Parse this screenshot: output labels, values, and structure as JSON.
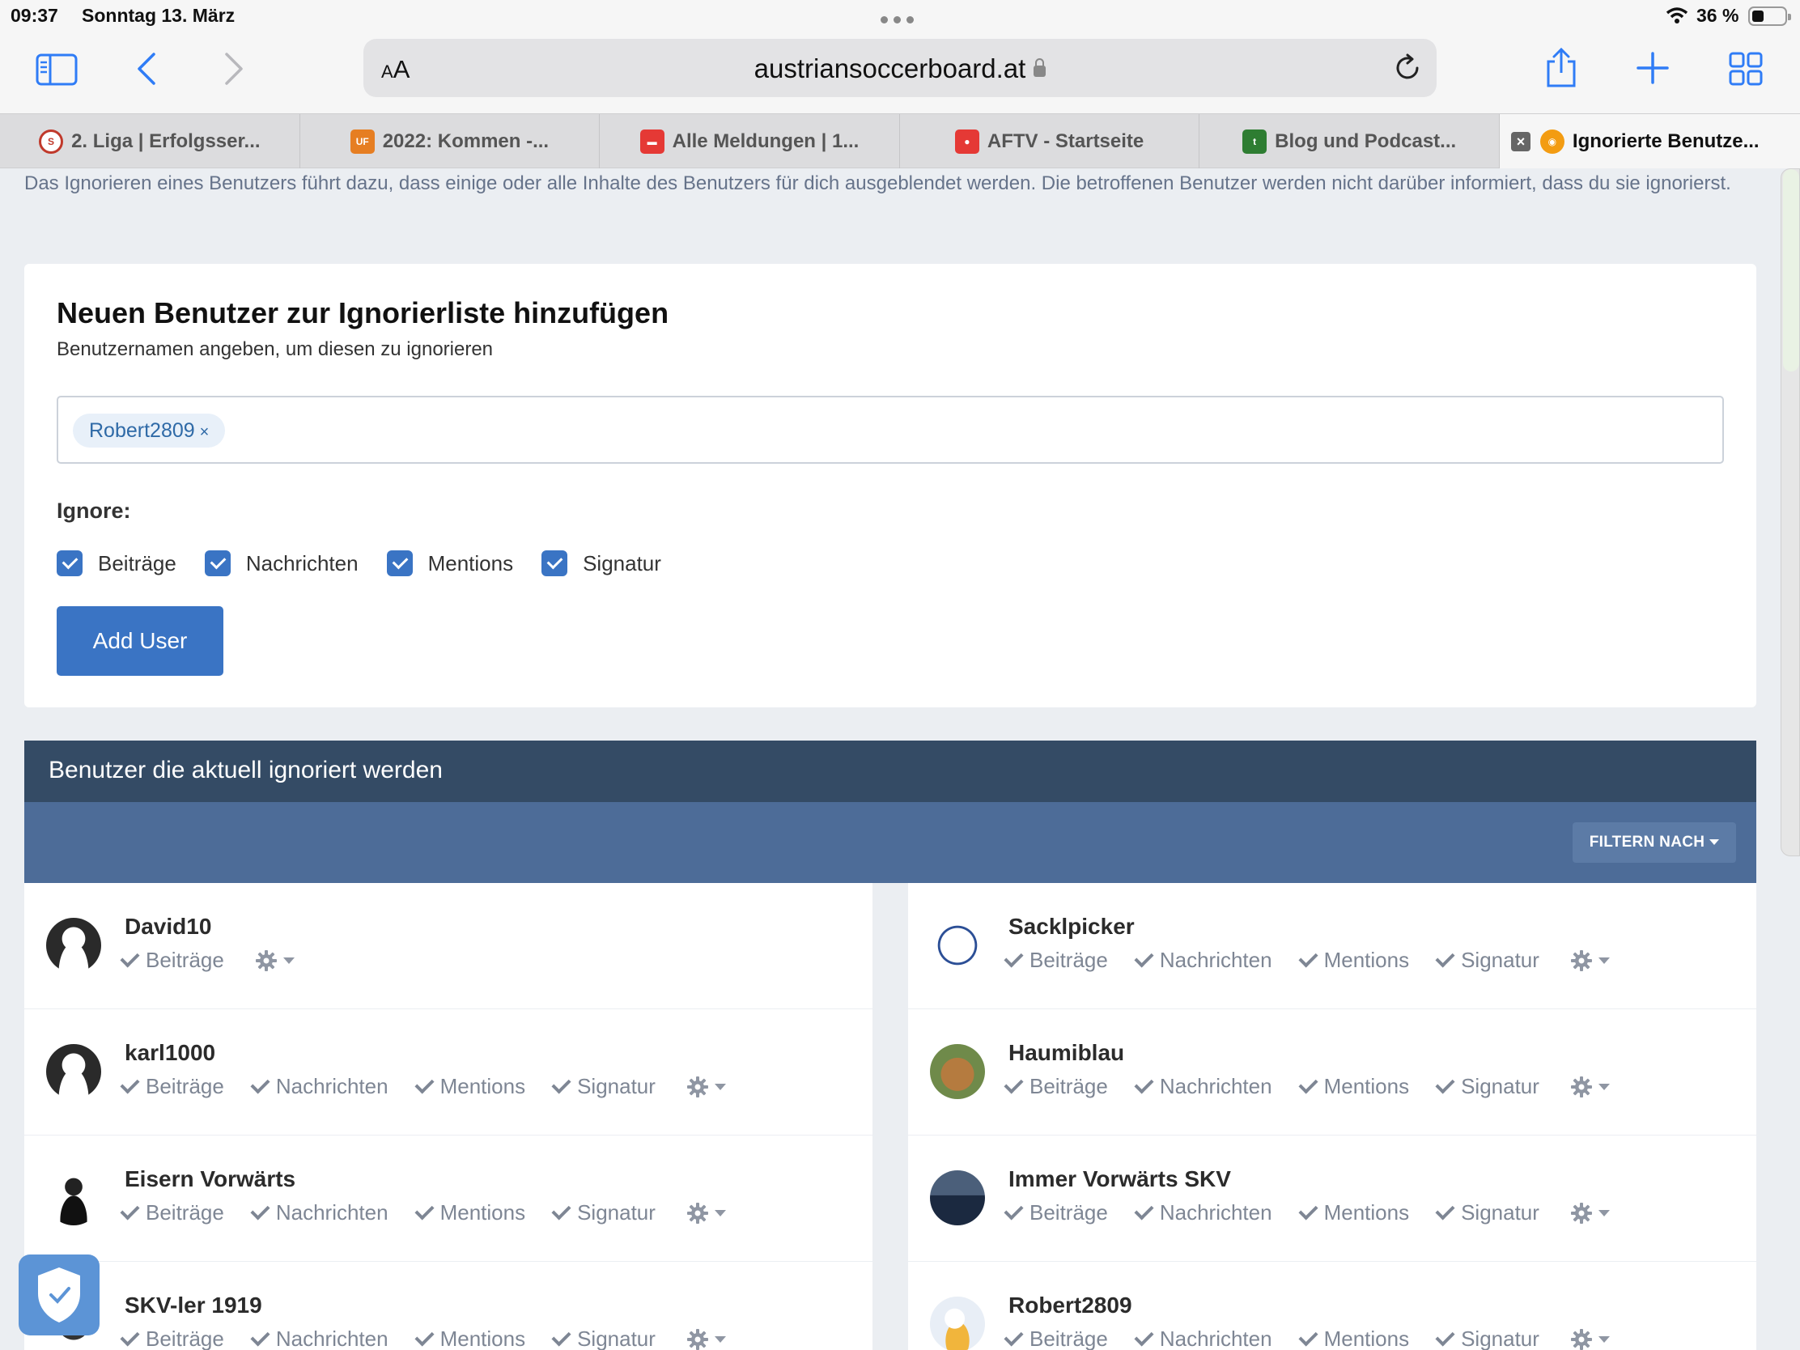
{
  "status": {
    "time": "09:37",
    "date": "Sonntag 13. März",
    "battery": "36 %"
  },
  "browser": {
    "aa_label": "AA",
    "url": "austriansoccerboard.at",
    "tabs": [
      {
        "label": "2. Liga | Erfolgsser...",
        "fav_color": "#c0392b"
      },
      {
        "label": "2022: Kommen -...",
        "fav_color": "#e67e22"
      },
      {
        "label": "Alle Meldungen | 1...",
        "fav_color": "#e53935"
      },
      {
        "label": "AFTV - Startseite",
        "fav_color": "#e53935"
      },
      {
        "label": "Blog und Podcast...",
        "fav_color": "#2e7d32"
      },
      {
        "label": "Ignorierte Benutze...",
        "fav_color": "#f39c12"
      }
    ]
  },
  "page": {
    "intro": "Das Ignorieren eines Benutzers führt dazu, dass einige oder alle Inhalte des Benutzers für dich ausgeblendet werden. Die betroffenen Benutzer werden nicht darüber informiert, dass du sie ignorierst.",
    "add_form": {
      "title": "Neuen Benutzer zur Ignorierliste hinzufügen",
      "subtitle": "Benutzernamen angeben, um diesen zu ignorieren",
      "chip": "Robert2809",
      "chip_remove": "×",
      "ignore_label": "Ignore:",
      "options": [
        "Beiträge",
        "Nachrichten",
        "Mentions",
        "Signatur"
      ],
      "button": "Add User"
    },
    "list": {
      "header": "Benutzer die aktuell ignoriert werden",
      "filter": "FILTERN NACH",
      "users": [
        {
          "name": "David10",
          "opts": [
            "Beiträge"
          ]
        },
        {
          "name": "Sacklpicker",
          "opts": [
            "Beiträge",
            "Nachrichten",
            "Mentions",
            "Signatur"
          ]
        },
        {
          "name": "karl1000",
          "opts": [
            "Beiträge",
            "Nachrichten",
            "Mentions",
            "Signatur"
          ]
        },
        {
          "name": "Haumiblau",
          "opts": [
            "Beiträge",
            "Nachrichten",
            "Mentions",
            "Signatur"
          ]
        },
        {
          "name": "Eisern Vorwärts",
          "opts": [
            "Beiträge",
            "Nachrichten",
            "Mentions",
            "Signatur"
          ]
        },
        {
          "name": "Immer Vorwärts SKV",
          "opts": [
            "Beiträge",
            "Nachrichten",
            "Mentions",
            "Signatur"
          ]
        },
        {
          "name": "SKV-ler 1919",
          "opts": [
            "Beiträge",
            "Nachrichten",
            "Mentions",
            "Signatur"
          ]
        },
        {
          "name": "Robert2809",
          "opts": [
            "Beiträge",
            "Nachrichten",
            "Mentions",
            "Signatur"
          ]
        }
      ]
    }
  },
  "colors": {
    "accent": "#3a74c4",
    "list_header": "#344b65",
    "filter_bar": "#4d6c98"
  }
}
